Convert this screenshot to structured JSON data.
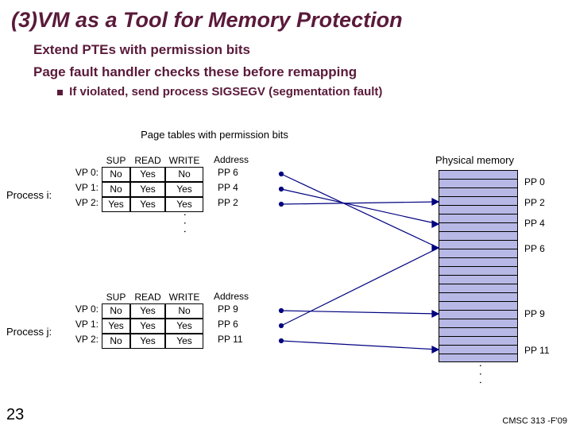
{
  "title": "(3)VM as a Tool for Memory Protection",
  "bullets": {
    "b1": "Extend PTEs with permission bits",
    "b2": "Page fault handler checks these before remapping",
    "b2a": "If violated, send process SIGSEGV (segmentation fault)"
  },
  "caption": "Page tables with permission  bits",
  "headers": {
    "sup": "SUP",
    "read": "READ",
    "write": "WRITE",
    "addr": "Address"
  },
  "process_i": {
    "label": "Process i:",
    "rows": [
      {
        "vp": "VP 0:",
        "sup": "No",
        "read": "Yes",
        "write": "No",
        "addr": "PP 6"
      },
      {
        "vp": "VP 1:",
        "sup": "No",
        "read": "Yes",
        "write": "Yes",
        "addr": "PP 4"
      },
      {
        "vp": "VP 2:",
        "sup": "Yes",
        "read": "Yes",
        "write": "Yes",
        "addr": "PP 2"
      }
    ]
  },
  "process_j": {
    "label": "Process j:",
    "rows": [
      {
        "vp": "VP 0:",
        "sup": "No",
        "read": "Yes",
        "write": "No",
        "addr": "PP 9"
      },
      {
        "vp": "VP 1:",
        "sup": "Yes",
        "read": "Yes",
        "write": "Yes",
        "addr": "PP 6"
      },
      {
        "vp": "VP 2:",
        "sup": "No",
        "read": "Yes",
        "write": "Yes",
        "addr": "PP 11"
      }
    ]
  },
  "phys": {
    "label": "Physical memory",
    "pp": [
      "PP 0",
      "PP 2",
      "PP 4",
      "PP 6",
      "PP 9",
      "PP 11"
    ]
  },
  "footer": {
    "page": "23",
    "course": "CMSC 313 -F'09"
  },
  "chart_data": {
    "type": "table",
    "title": "Page tables with permission bits",
    "tables": [
      {
        "process": "Process i",
        "columns": [
          "VP",
          "SUP",
          "READ",
          "WRITE",
          "Address"
        ],
        "rows": [
          [
            "VP 0",
            "No",
            "Yes",
            "No",
            "PP 6"
          ],
          [
            "VP 1",
            "No",
            "Yes",
            "Yes",
            "PP 4"
          ],
          [
            "VP 2",
            "Yes",
            "Yes",
            "Yes",
            "PP 2"
          ]
        ]
      },
      {
        "process": "Process j",
        "columns": [
          "VP",
          "SUP",
          "READ",
          "WRITE",
          "Address"
        ],
        "rows": [
          [
            "VP 0",
            "No",
            "Yes",
            "No",
            "PP 9"
          ],
          [
            "VP 1",
            "Yes",
            "Yes",
            "Yes",
            "PP 6"
          ],
          [
            "VP 2",
            "No",
            "Yes",
            "Yes",
            "PP 11"
          ]
        ]
      }
    ],
    "physical_pages_shown": [
      "PP 0",
      "PP 2",
      "PP 4",
      "PP 6",
      "PP 9",
      "PP 11"
    ]
  }
}
